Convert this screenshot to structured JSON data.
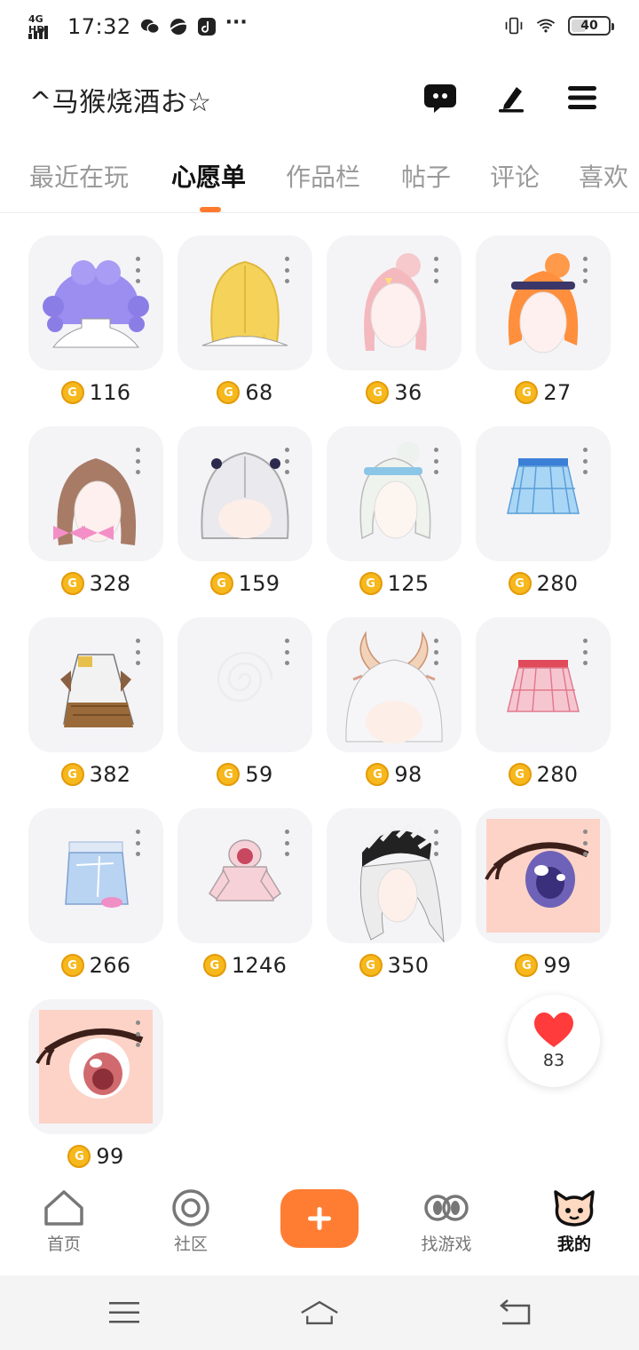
{
  "status_bar": {
    "network": "4G HD",
    "time": "17:32",
    "battery": "40",
    "battery_level": 0.4
  },
  "header": {
    "username": "^马猴烧酒お☆",
    "icons": [
      "chat-icon",
      "edit-icon",
      "menu-icon"
    ]
  },
  "tabs": [
    {
      "label": "最近在玩"
    },
    {
      "label": "心愿单",
      "active": true
    },
    {
      "label": "作品栏"
    },
    {
      "label": "帖子"
    },
    {
      "label": "评论"
    },
    {
      "label": "喜欢"
    }
  ],
  "wishlist": {
    "coin_symbol": "G",
    "items": [
      {
        "price": "116",
        "kind": "hair-purple-twin-drills"
      },
      {
        "price": "68",
        "kind": "hair-blonde-long"
      },
      {
        "price": "36",
        "kind": "hair-pink-bun"
      },
      {
        "price": "27",
        "kind": "hair-orange-bun-headband"
      },
      {
        "price": "328",
        "kind": "hair-brown-ribbons"
      },
      {
        "price": "159",
        "kind": "hair-silver-long-bows"
      },
      {
        "price": "125",
        "kind": "hair-white-headband"
      },
      {
        "price": "280",
        "kind": "skirt-blue-plaid"
      },
      {
        "price": "382",
        "kind": "outfit-brown-gothic"
      },
      {
        "price": "59",
        "kind": "swirl-effect"
      },
      {
        "price": "98",
        "kind": "hair-white-horns"
      },
      {
        "price": "280",
        "kind": "skirt-pink-plaid"
      },
      {
        "price": "266",
        "kind": "skirt-denim"
      },
      {
        "price": "1246",
        "kind": "hoodie-pink"
      },
      {
        "price": "350",
        "kind": "hair-beanie-striped"
      },
      {
        "price": "99",
        "kind": "eye-purple"
      },
      {
        "price": "99",
        "kind": "eye-red"
      }
    ]
  },
  "like": {
    "count": "83",
    "color": "#ff3b3b"
  },
  "bottom_nav": {
    "items": [
      {
        "label": "首页",
        "icon": "home-icon"
      },
      {
        "label": "社区",
        "icon": "community-icon"
      },
      {
        "label": "+",
        "icon": "add-icon"
      },
      {
        "label": "找游戏",
        "icon": "find-game-icon"
      },
      {
        "label": "我的",
        "icon": "profile-icon",
        "active": true
      }
    ]
  },
  "colors": {
    "accent": "#ff7a2e",
    "coin": "#f6b81c"
  }
}
